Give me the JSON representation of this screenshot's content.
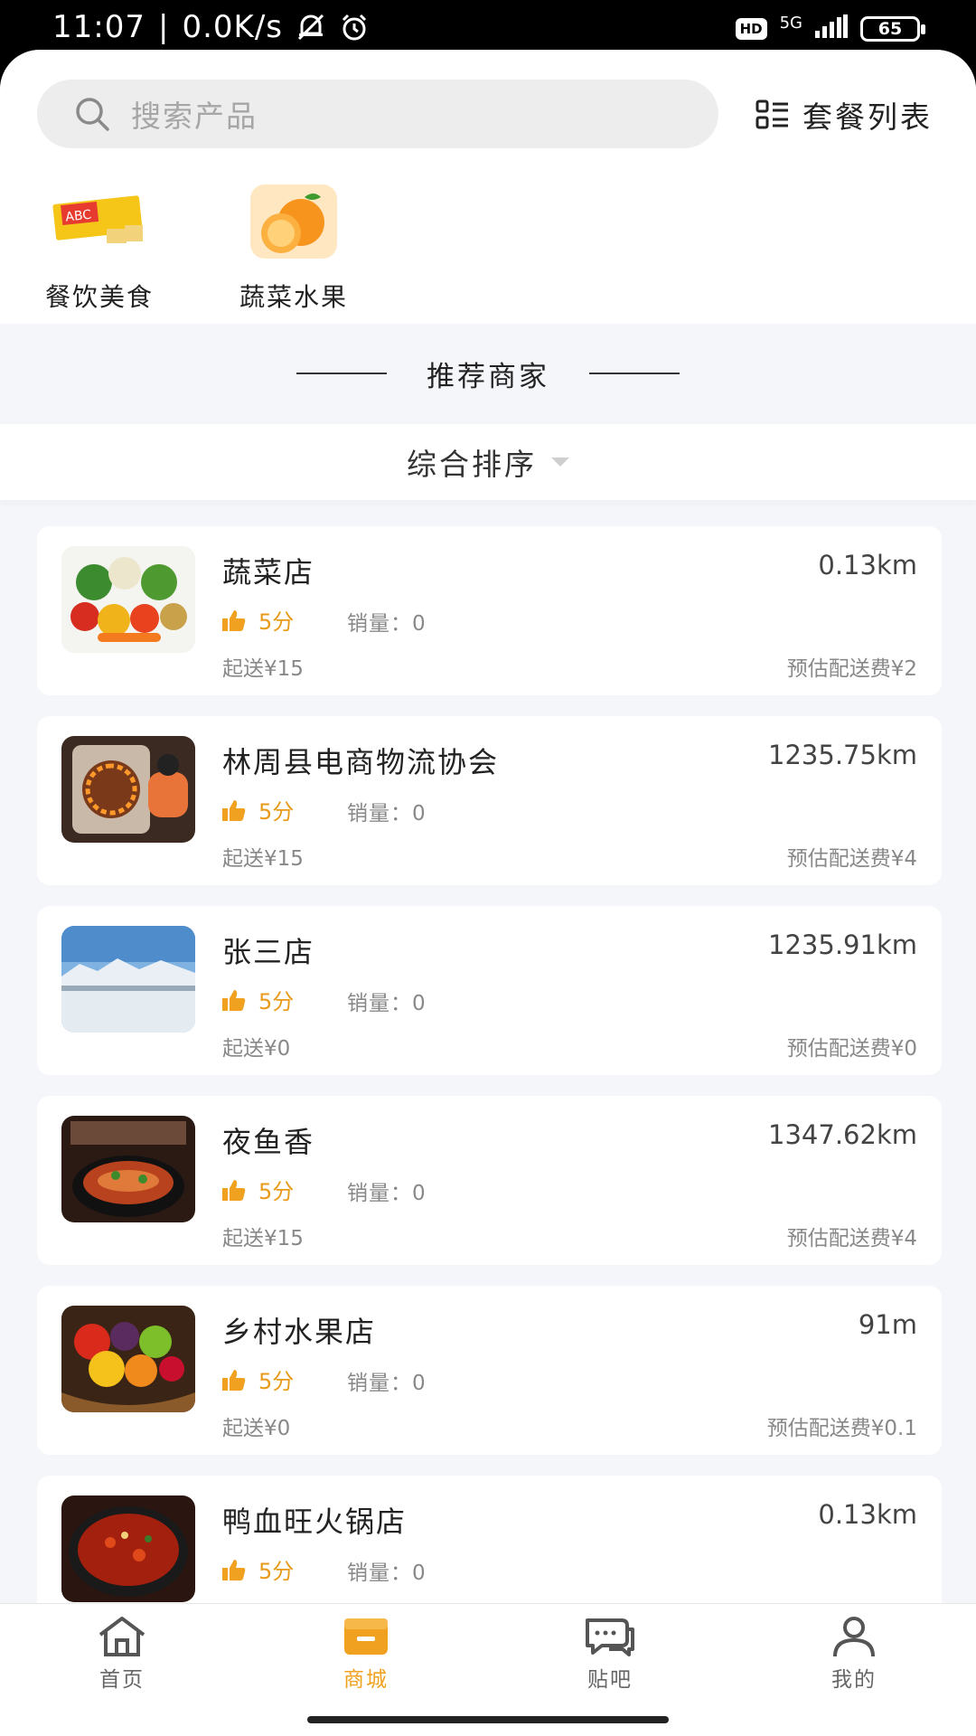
{
  "status_bar": {
    "time": "11:07",
    "speed": "0.0K/s",
    "hd": "HD",
    "network": "5G",
    "battery": "65"
  },
  "search": {
    "placeholder": "搜索产品",
    "package_list_label": "套餐列表"
  },
  "categories": [
    {
      "label": "餐饮美食",
      "icon": "snack-food-image"
    },
    {
      "label": "蔬菜水果",
      "icon": "orange-fruit-image"
    }
  ],
  "section": {
    "title": "推荐商家",
    "sort_label": "综合排序"
  },
  "shops": [
    {
      "name": "蔬菜店",
      "distance": "0.13km",
      "score": "5分",
      "sales": "销量：0",
      "min_order": "起送¥15",
      "fee": "预估配送费¥2",
      "image": "vegetables-image"
    },
    {
      "name": "林周县电商物流协会",
      "distance": "1235.75km",
      "score": "5分",
      "sales": "销量：0",
      "min_order": "起送¥15",
      "fee": "预估配送费¥4",
      "image": "heater-image"
    },
    {
      "name": "张三店",
      "distance": "1235.91km",
      "score": "5分",
      "sales": "销量：0",
      "min_order": "起送¥0",
      "fee": "预估配送费¥0",
      "image": "snow-mountain-image"
    },
    {
      "name": "夜鱼香",
      "distance": "1347.62km",
      "score": "5分",
      "sales": "销量：0",
      "min_order": "起送¥15",
      "fee": "预估配送费¥4",
      "image": "grilled-fish-image"
    },
    {
      "name": "乡村水果店",
      "distance": "91m",
      "score": "5分",
      "sales": "销量：0",
      "min_order": "起送¥0",
      "fee": "预估配送费¥0.1",
      "image": "fruit-basket-image"
    },
    {
      "name": "鸭血旺火锅店",
      "distance": "0.13km",
      "score": "5分",
      "sales": "销量：0",
      "min_order": "",
      "fee": "",
      "image": "hotpot-image"
    }
  ],
  "tabs": [
    {
      "label": "首页",
      "icon": "home-icon",
      "active": false
    },
    {
      "label": "商城",
      "icon": "shop-icon",
      "active": true
    },
    {
      "label": "贴吧",
      "icon": "chat-icon",
      "active": false
    },
    {
      "label": "我的",
      "icon": "person-icon",
      "active": false
    }
  ],
  "colors": {
    "accent": "#f0a120",
    "background": "#f5f6fa"
  }
}
